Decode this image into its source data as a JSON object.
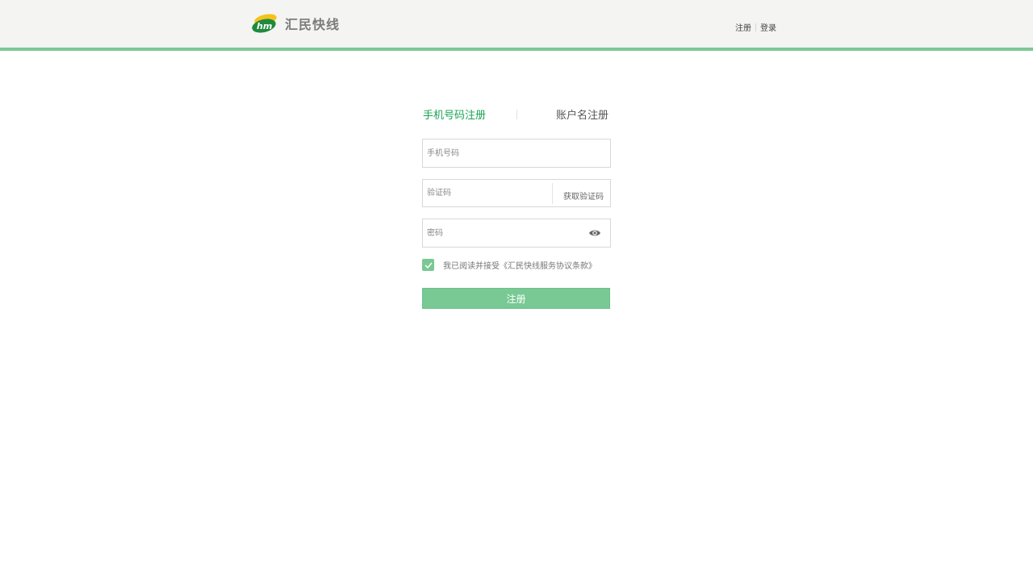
{
  "brand": {
    "name": "汇民快线",
    "logo_icon": "hm-logo-icon",
    "accent_color": "#1aa354",
    "button_color": "#78c994"
  },
  "header": {
    "links": [
      "注册",
      "登录"
    ]
  },
  "tabs": [
    {
      "label": "手机号码注册",
      "active": true
    },
    {
      "label": "账户名注册",
      "active": false
    }
  ],
  "form": {
    "phone_placeholder": "手机号码",
    "code_placeholder": "验证码",
    "code_button": "获取验证码",
    "password_placeholder": "密码",
    "password_toggle_icon": "eye-icon",
    "agreement_checked": true,
    "agreement_text": "我已阅读并接受《汇民快线服务协议条款》",
    "submit_label": "注册"
  }
}
